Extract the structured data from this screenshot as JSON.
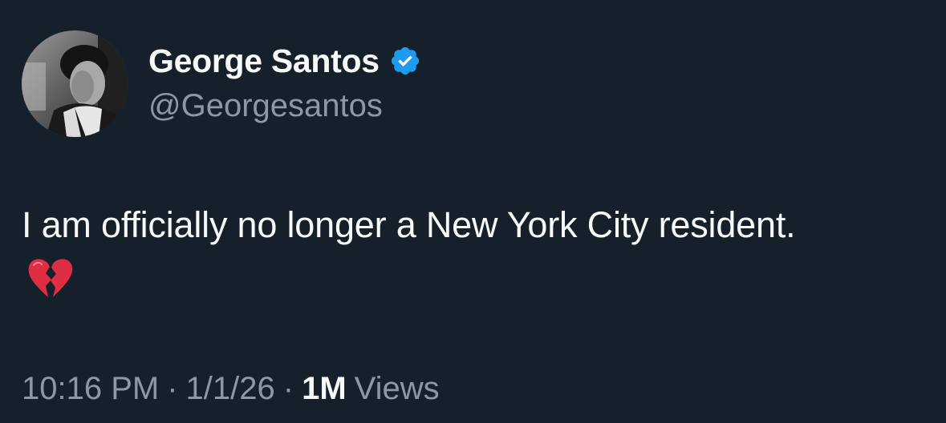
{
  "author": {
    "display_name": "George Santos",
    "handle": "@Georgesantos",
    "verified": true,
    "avatar_icon": "profile-photo"
  },
  "tweet": {
    "text": "I am officially no longer a New York City resident.",
    "emoji": "💔",
    "emoji_name": "broken-heart-icon"
  },
  "meta": {
    "time": "10:16 PM",
    "separator": "·",
    "date": "1/1/26",
    "views_count": "1M",
    "views_label": "Views"
  },
  "colors": {
    "background": "#15202b",
    "text_primary": "#f7f9f9",
    "text_secondary": "#8b98a5",
    "verified_badge": "#1d9bf0",
    "emoji_red": "#dd2e44"
  }
}
